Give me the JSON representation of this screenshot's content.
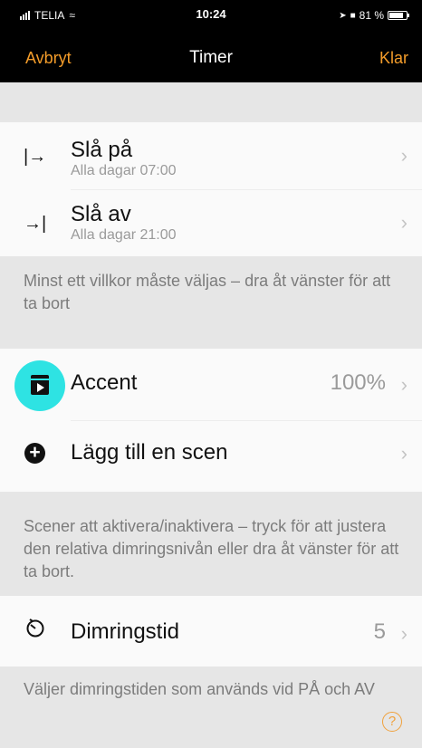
{
  "status_bar": {
    "carrier": "TELIA",
    "time": "10:24",
    "battery_text": "81 %"
  },
  "nav": {
    "cancel_label": "Avbryt",
    "title": "Timer",
    "done_label": "Klar"
  },
  "conditions": {
    "items": [
      {
        "icon": "arrow-to-line-right-icon",
        "glyph": "|→",
        "title": "Slå på",
        "subtitle": "Alla dagar  07:00"
      },
      {
        "icon": "arrow-to-line-left-icon",
        "glyph": "→|",
        "title": "Slå av",
        "subtitle": "Alla dagar  21:00"
      }
    ],
    "note": "Minst ett villkor måste väljas – dra åt vänster för att ta bort"
  },
  "scenes": {
    "items": [
      {
        "icon": "clapperboard-icon",
        "title": "Accent",
        "value": "100%"
      },
      {
        "icon": "plus-circle-icon",
        "title": "Lägg till en scen",
        "value": ""
      }
    ],
    "note": "Scener att aktivera/inaktivera – tryck för att justera den relativa dimringsnivån eller dra åt vänster för att ta bort."
  },
  "dimming": {
    "title": "Dimringstid",
    "value": "5",
    "note": "Väljer dimringstiden som används vid PÅ och AV"
  },
  "colors": {
    "accent": "#f39c2a",
    "highlight": "#2ee3e3",
    "background": "#e6e6e6",
    "row_background": "#fafafa"
  }
}
